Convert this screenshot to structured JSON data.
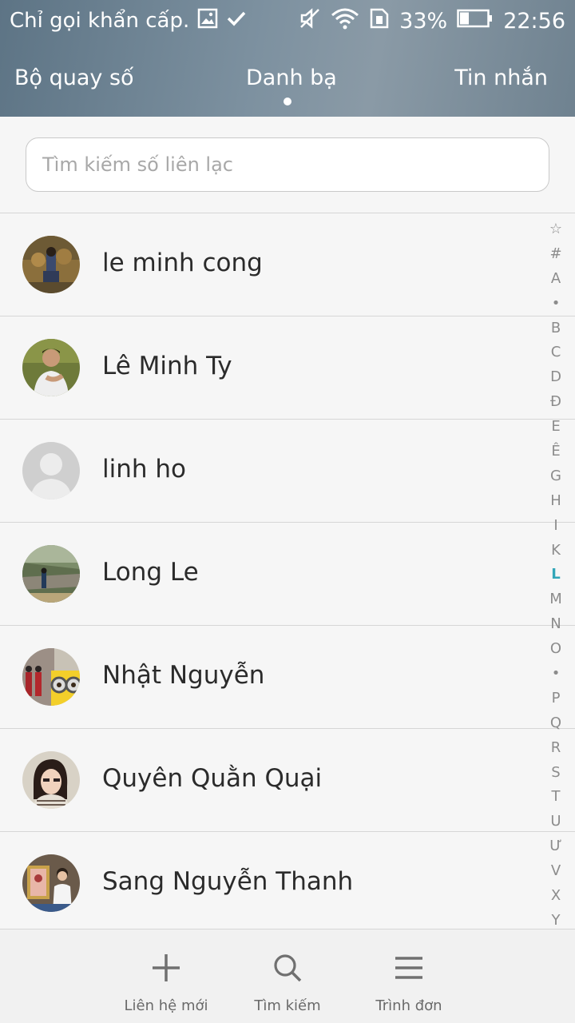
{
  "status_bar": {
    "notification_text": "Chỉ gọi khẩn cấp.",
    "battery": "33%",
    "time": "22:56"
  },
  "tabs": [
    {
      "label": "Bộ quay số"
    },
    {
      "label": "Danh bạ",
      "active": true
    },
    {
      "label": "Tin nhắn"
    }
  ],
  "search": {
    "placeholder": "Tìm kiếm số liên lạc"
  },
  "contacts": [
    {
      "name": "le minh cong",
      "avatar": "photo"
    },
    {
      "name": "Lê Minh Ty",
      "avatar": "photo"
    },
    {
      "name": "linh ho",
      "avatar": "default-person"
    },
    {
      "name": "Long Le",
      "avatar": "photo"
    },
    {
      "name": "Nhật Nguyễn",
      "avatar": "photo"
    },
    {
      "name": "Quyên Quằn Quại",
      "avatar": "photo"
    },
    {
      "name": "Sang Nguyễn Thanh",
      "avatar": "photo"
    }
  ],
  "alpha_index": [
    "☆",
    "#",
    "A",
    "•",
    "B",
    "C",
    "D",
    "Đ",
    "E",
    "Ê",
    "G",
    "H",
    "I",
    "K",
    "L",
    "M",
    "N",
    "O",
    "•",
    "P",
    "Q",
    "R",
    "S",
    "T",
    "U",
    "Ư",
    "V",
    "X",
    "Y"
  ],
  "alpha_active": "L",
  "bottom_bar": {
    "new_contact": "Liên hệ mới",
    "search": "Tìm kiếm",
    "menu": "Trình đơn"
  },
  "colors": {
    "accent": "#33a6b8",
    "header": "#6f8290"
  }
}
